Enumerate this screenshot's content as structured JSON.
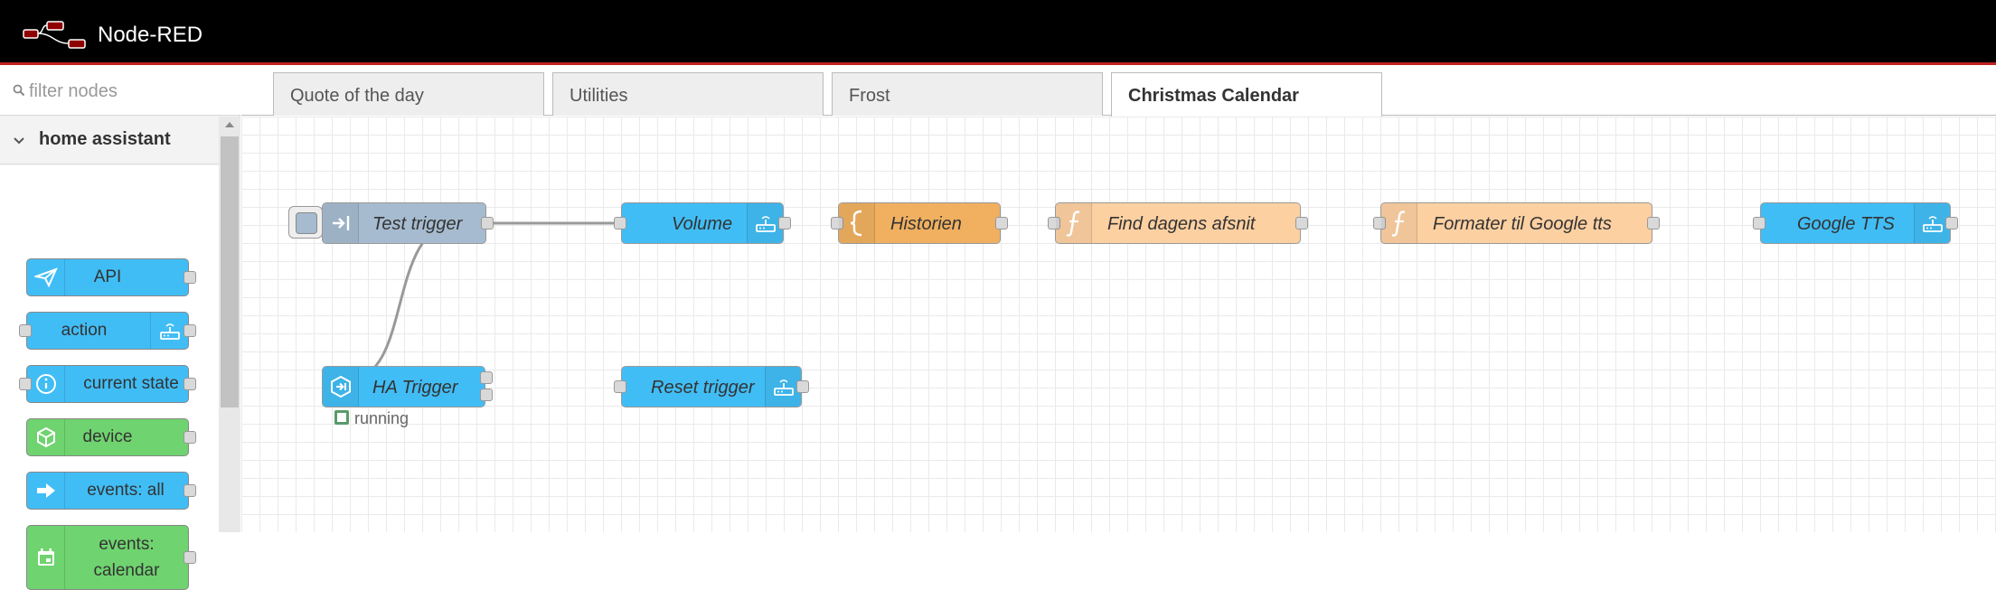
{
  "app": {
    "title": "Node-RED"
  },
  "palette": {
    "filter_placeholder": "filter nodes",
    "category": "home assistant",
    "nodes": [
      {
        "label": "API",
        "color": "#41bdf5",
        "icon": "paper-plane-icon"
      },
      {
        "label": "action",
        "color": "#41bdf5",
        "icon": "router-icon"
      },
      {
        "label": "current state",
        "color": "#41bdf5",
        "icon": "info-icon"
      },
      {
        "label": "device",
        "color": "#6fd36f",
        "icon": "cube-icon"
      },
      {
        "label": "events: all",
        "color": "#41bdf5",
        "icon": "arrow-right-icon"
      },
      {
        "label": "events:\ncalendar",
        "color": "#6fd36f",
        "icon": "calendar-icon"
      }
    ]
  },
  "tabs": [
    {
      "label": "Quote of the day",
      "active": false
    },
    {
      "label": "Utilities",
      "active": false
    },
    {
      "label": "Frost",
      "active": false
    },
    {
      "label": "Christmas Calendar",
      "active": true
    }
  ],
  "flow": {
    "nodes": [
      {
        "id": "test-trigger",
        "label": "Test trigger",
        "color": "#a6bbcf"
      },
      {
        "id": "volume",
        "label": "Volume",
        "color": "#41bdf5"
      },
      {
        "id": "historien",
        "label": "Historien",
        "color": "#f0b060"
      },
      {
        "id": "find-dagens",
        "label": "Find dagens afsnit",
        "color": "#fdd0a2"
      },
      {
        "id": "formater",
        "label": "Formater til Google tts",
        "color": "#fdd0a2"
      },
      {
        "id": "google-tts",
        "label": "Google TTS",
        "color": "#41bdf5"
      },
      {
        "id": "ha-trigger",
        "label": "HA Trigger",
        "color": "#41bdf5"
      },
      {
        "id": "reset-trigger",
        "label": "Reset trigger",
        "color": "#41bdf5"
      }
    ],
    "status": {
      "node": "ha-trigger",
      "text": "running"
    }
  }
}
